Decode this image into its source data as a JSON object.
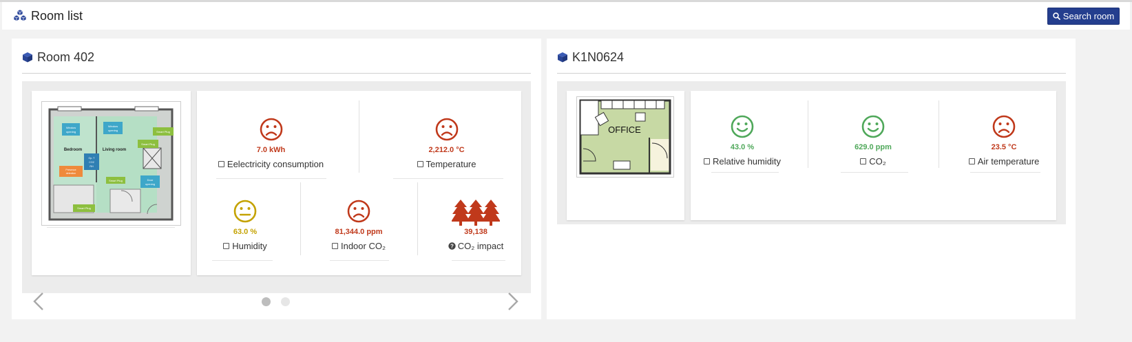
{
  "header": {
    "title": "Room list",
    "search_button": "Search room"
  },
  "colors": {
    "primary": "#243e8e",
    "sad": "#c0391b",
    "happy": "#4fa85a",
    "neutral": "#c4a200"
  },
  "rooms": [
    {
      "name": "Room 402",
      "floorplan_labels": [
        "Window opening",
        "Window opening",
        "Smart Plug",
        "Smart Plug",
        "Bedroom",
        "Living room",
        "Op. T CO2 RH",
        "Presence detection",
        "Smart Plug",
        "Door opening",
        "Smart Plug"
      ],
      "metrics": [
        {
          "value": "7.0 kWh",
          "label": "Eelectricity consumption",
          "mood": "sad",
          "icon": "checkbox-icon"
        },
        {
          "value": "2,212.0 °C",
          "label": "Temperature",
          "mood": "sad",
          "icon": "checkbox-icon"
        },
        {
          "value": "63.0 %",
          "label": "Humidity",
          "mood": "neutral",
          "icon": "checkbox-icon"
        },
        {
          "value": "81,344.0 ppm",
          "label": "Indoor CO₂",
          "mood": "sad",
          "icon": "checkbox-icon"
        },
        {
          "value": "39,138",
          "label": "CO₂ impact",
          "mood": "trees",
          "icon": "question-circle-icon"
        }
      ],
      "carousel": {
        "pages": 2,
        "active": 1
      }
    },
    {
      "name": "K1N0624",
      "floorplan_labels": [
        "OFFICE"
      ],
      "metrics": [
        {
          "value": "43.0 %",
          "label": "Relative humidity",
          "mood": "happy",
          "icon": "checkbox-icon"
        },
        {
          "value": "629.0 ppm",
          "label": "CO₂",
          "mood": "happy",
          "icon": "checkbox-icon"
        },
        {
          "value": "23.5 °C",
          "label": "Air temperature",
          "mood": "sad",
          "icon": "checkbox-icon"
        }
      ]
    }
  ]
}
